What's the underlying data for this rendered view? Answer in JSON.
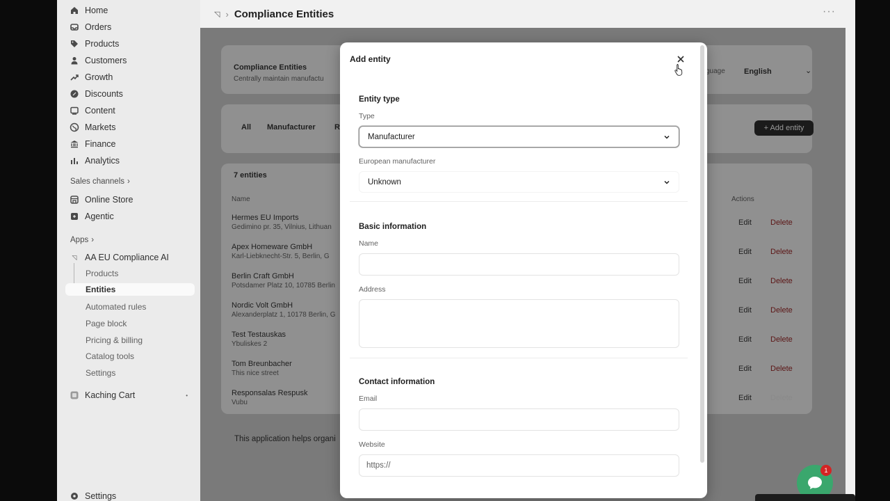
{
  "sidebar": {
    "nav": [
      {
        "label": "Home",
        "icon": "home-icon"
      },
      {
        "label": "Orders",
        "icon": "orders-icon"
      },
      {
        "label": "Products",
        "icon": "tag-icon"
      },
      {
        "label": "Customers",
        "icon": "person-icon"
      },
      {
        "label": "Growth",
        "icon": "growth-icon"
      },
      {
        "label": "Discounts",
        "icon": "discount-icon"
      },
      {
        "label": "Content",
        "icon": "content-icon"
      },
      {
        "label": "Markets",
        "icon": "globe-icon"
      },
      {
        "label": "Finance",
        "icon": "bank-icon"
      },
      {
        "label": "Analytics",
        "icon": "bar-chart-icon"
      }
    ],
    "sales_channels_label": "Sales channels",
    "channels": [
      {
        "label": "Online Store",
        "icon": "store-icon"
      },
      {
        "label": "Agentic",
        "icon": "agent-icon"
      }
    ],
    "apps_label": "Apps",
    "app_name": "AA EU Compliance AI",
    "app_items": [
      "Products",
      "Entities",
      "Automated rules",
      "Page block",
      "Pricing & billing",
      "Catalog tools",
      "Settings"
    ],
    "other_app": "Kaching Cart",
    "settings_label": "Settings"
  },
  "topbar": {
    "title": "Compliance Entities",
    "more": "···"
  },
  "background_page": {
    "card_title": "Compliance Entities",
    "card_subtitle": "Centrally maintain manufactu",
    "language_label": "guage",
    "language_value": "English",
    "tabs": [
      "All",
      "Manufacturer",
      "R"
    ],
    "add_button": "+ Add entity",
    "count": "7 entities",
    "col_name": "Name",
    "col_actions": "Actions",
    "edit_label": "Edit",
    "delete_label": "Delete",
    "rows": [
      {
        "name": "Hermes EU Imports",
        "address": "Gedimino pr. 35, Vilnius, Lithuan"
      },
      {
        "name": "Apex Homeware GmbH",
        "address": "Karl-Liebknecht-Str. 5, Berlin, G"
      },
      {
        "name": "Berlin Craft GmbH",
        "address": "Potsdamer Platz 10, 10785 Berlin"
      },
      {
        "name": "Nordic Volt GmbH",
        "address": "Alexanderplatz 1, 10178 Berlin, G"
      },
      {
        "name": "Test Testauskas",
        "address": "Ybuliskes 2"
      },
      {
        "name": "Tom Breunbacher",
        "address": "This nice street"
      },
      {
        "name": "Responsalas Respusk",
        "address": "Vubu"
      }
    ],
    "footer_text": "This application helps organi"
  },
  "modal": {
    "title": "Add entity",
    "entity_type_heading": "Entity type",
    "type_label": "Type",
    "type_value": "Manufacturer",
    "eu_manufacturer_label": "European manufacturer",
    "eu_manufacturer_value": "Unknown",
    "basic_heading": "Basic information",
    "name_label": "Name",
    "name_value": "",
    "address_label": "Address",
    "address_value": "",
    "contact_heading": "Contact information",
    "email_label": "Email",
    "email_value": "",
    "website_label": "Website",
    "website_placeholder": "https://"
  },
  "chat": {
    "badge": "1"
  }
}
